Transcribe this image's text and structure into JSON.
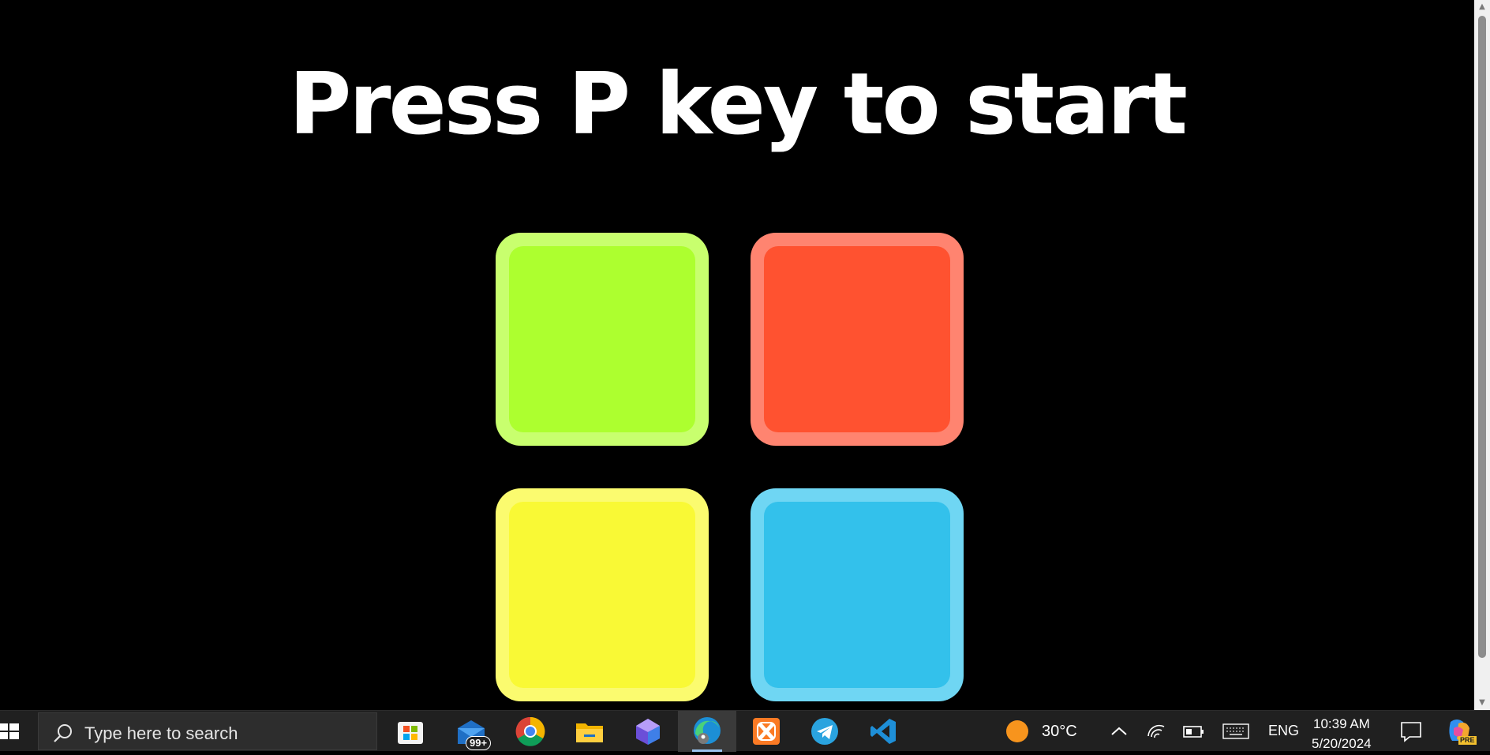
{
  "game": {
    "title": "Press P key to start",
    "pads": [
      {
        "name": "green",
        "fill": "#adff2f",
        "rim": "#c8ff6e"
      },
      {
        "name": "red",
        "fill": "#ff5230",
        "rim": "#ff8470"
      },
      {
        "name": "yellow",
        "fill": "#f9f935",
        "rim": "#fbfb6f"
      },
      {
        "name": "blue",
        "fill": "#33c1eb",
        "rim": "#6fd6f3"
      }
    ]
  },
  "taskbar": {
    "search_placeholder": "Type here to search",
    "mail_badge": "99+",
    "weather_temp": "30°C",
    "language": "ENG",
    "clock_time": "10:39 AM",
    "clock_date": "5/20/2024",
    "apps": [
      {
        "icon": "microsoft-store-icon"
      },
      {
        "icon": "mail-icon"
      },
      {
        "icon": "chrome-icon"
      },
      {
        "icon": "file-explorer-icon"
      },
      {
        "icon": "microsoft-365-icon"
      },
      {
        "icon": "edge-icon",
        "active": true
      },
      {
        "icon": "xampp-icon"
      },
      {
        "icon": "telegram-icon"
      },
      {
        "icon": "vscode-icon"
      }
    ],
    "copilot_badge": "PRE"
  }
}
